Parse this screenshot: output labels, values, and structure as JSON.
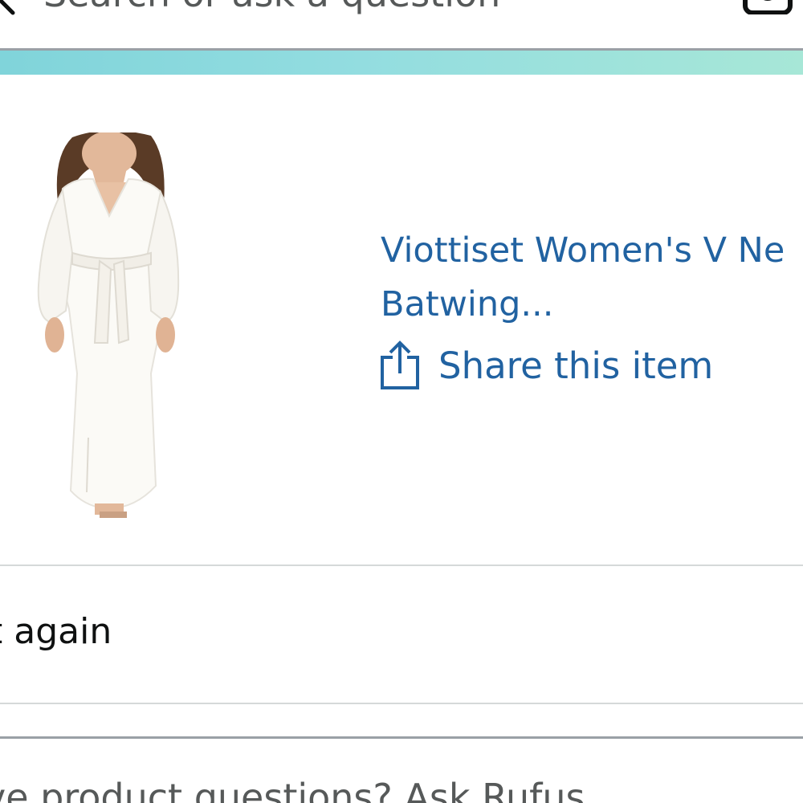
{
  "search": {
    "placeholder": "Search or ask a question",
    "back_icon": "chevron-left-icon",
    "camera_icon": "camera-lens-icon"
  },
  "colors": {
    "link_blue": "#2162a1",
    "strip_start": "#80d4da",
    "strip_end": "#a7e7d7",
    "text_dark": "#0f1111",
    "text_muted": "#565959"
  },
  "product": {
    "title_line1": "Viottiset Women's V Ne",
    "title_line2": "Batwing...",
    "image_icon": "white-batwing-sweater-dress",
    "share_label": "Share this item",
    "share_icon": "share-icon"
  },
  "actions": {
    "buy_again_label": "t again"
  },
  "rufus": {
    "prompt": "ve product questions? Ask Rufus"
  }
}
